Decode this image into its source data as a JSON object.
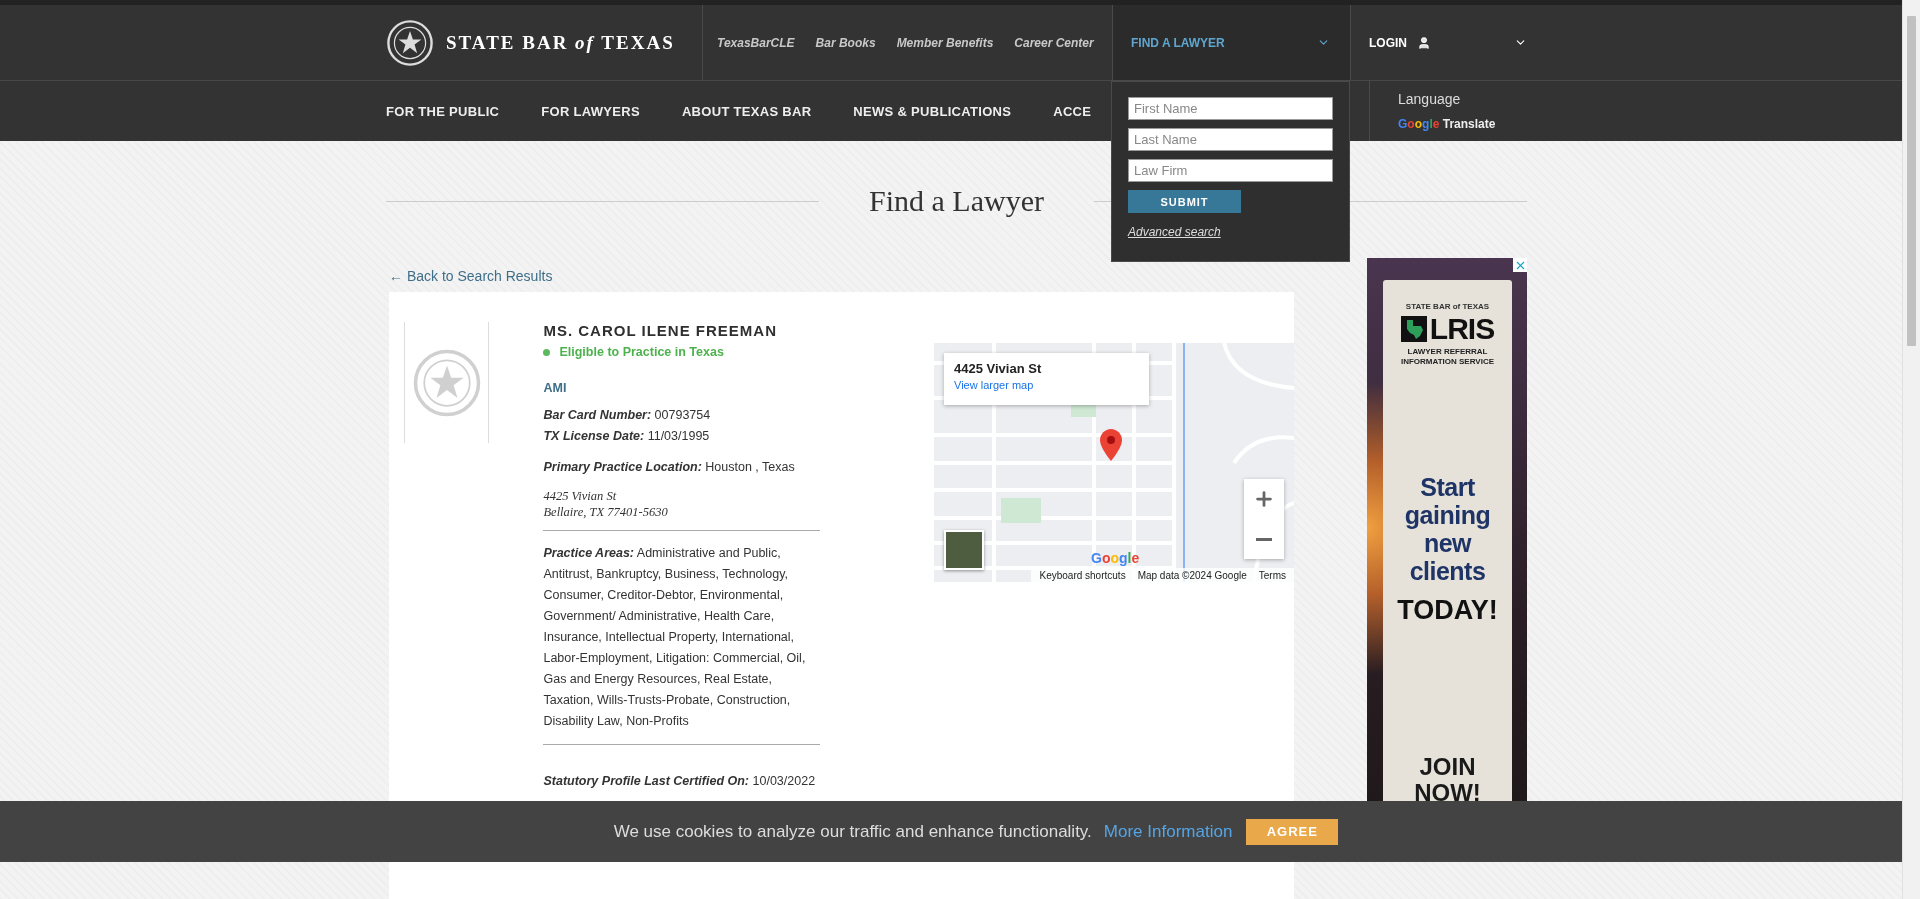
{
  "header": {
    "logo": "STATE BAR *of* TEXAS",
    "top_links": [
      {
        "label": "TexasBarCLE"
      },
      {
        "label": "Bar Books"
      },
      {
        "label": "Member Benefits"
      },
      {
        "label": "Career Center"
      }
    ],
    "find_lawyer": {
      "label": "FIND A LAWYER",
      "expanded": true
    },
    "login": {
      "label": "LOGIN"
    }
  },
  "nav": {
    "items": [
      {
        "label": "FOR THE PUBLIC"
      },
      {
        "label": "FOR LAWYERS"
      },
      {
        "label": "ABOUT TEXAS BAR"
      },
      {
        "label": "NEWS & PUBLICATIONS"
      },
      {
        "label": "ACCE"
      }
    ],
    "language": "Language",
    "translate": {
      "logo": "Google",
      "label": "Translate"
    }
  },
  "search_dropdown": {
    "fields": [
      {
        "placeholder": "First Name"
      },
      {
        "placeholder": "Last Name"
      },
      {
        "placeholder": "Law Firm"
      }
    ],
    "submit": "SUBMIT",
    "advanced": "Advanced search"
  },
  "page_title": "Find a Lawyer",
  "back_link": "← Back to Search Results",
  "profile": {
    "name": "MS. CAROL ILENE FREEMAN",
    "status": "Eligible to Practice in Texas",
    "firm": "AMI",
    "facts": [
      {
        "label": "Bar Card Number:",
        "value": "00793754"
      },
      {
        "label": "TX License Date:",
        "value": "11/03/1995"
      }
    ],
    "location": {
      "label": "Primary Practice Location:",
      "value": "Houston , Texas"
    },
    "address": [
      "4425 Vivian St",
      "Bellaire, TX 77401-5630"
    ],
    "practice_areas": {
      "label": "Practice Areas:",
      "value": "Administrative and Public, Antitrust, Bankruptcy, Business, Technology, Consumer, Creditor-Debtor, Environmental, Government/ Administrative, Health Care, Insurance, Intellectual Property, International, Labor-Employment, Litigation: Commercial, Oil, Gas and Energy Resources, Real Estate, Taxation, Wills-Trusts-Probate, Construction, Disability Law, Non-Profits"
    },
    "certified": {
      "label": "Statutory Profile Last Certified On:",
      "value": "10/03/2022"
    }
  },
  "map": {
    "place": "4425 Vivian St",
    "larger_link": "View larger map",
    "logo": "Google",
    "attribution": [
      "Keyboard shortcuts",
      "Map data ©2024 Google",
      "Terms"
    ]
  },
  "ad": {
    "brand_line": "STATE BAR of TEXAS",
    "logo": "LRIS",
    "tagline": "LAWYER REFERRAL INFORMATION SERVICE",
    "headline": "Start gaining new clients",
    "emphasis": "TODAY!",
    "cta": "JOIN NOW!"
  },
  "cookie_bar": {
    "message": "We use cookies to analyze our traffic and enhance functionality.",
    "link": "More Information",
    "button": "AGREE"
  }
}
